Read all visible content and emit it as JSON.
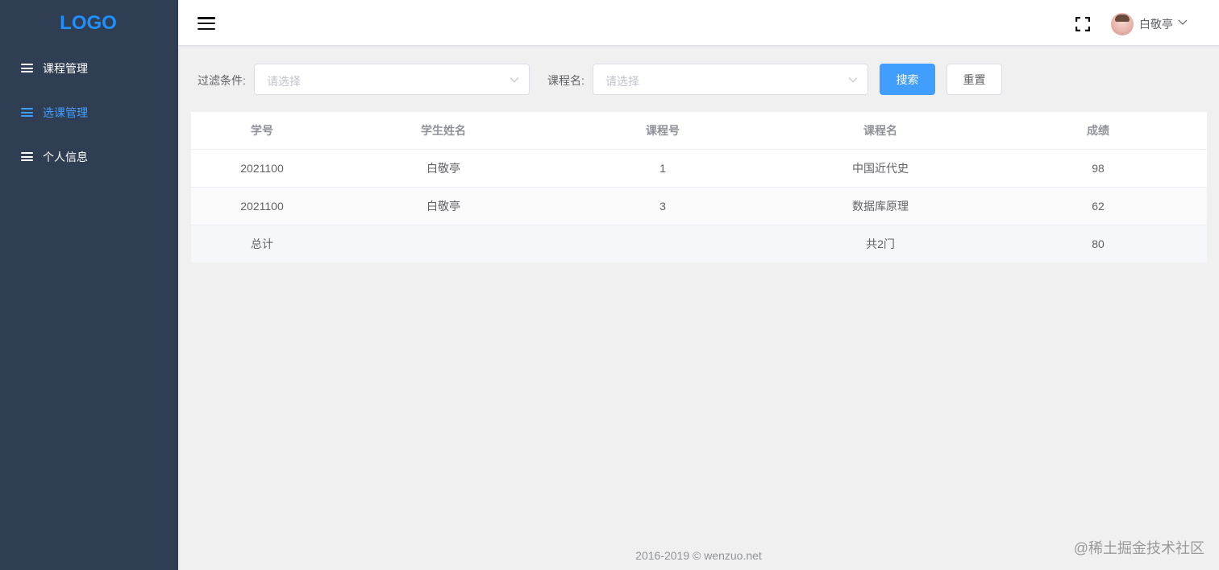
{
  "sidebar": {
    "logo": "LOGO",
    "items": [
      {
        "label": "课程管理",
        "active": false
      },
      {
        "label": "选课管理",
        "active": true
      },
      {
        "label": "个人信息",
        "active": false
      }
    ]
  },
  "header": {
    "username": "白敬亭",
    "icons": [
      "hamburger-icon",
      "fullscreen-icon",
      "chevron-down-icon"
    ]
  },
  "filters": {
    "filter_label": "过滤条件:",
    "filter_placeholder": "请选择",
    "course_label": "课程名:",
    "course_placeholder": "请选择",
    "search_button": "搜索",
    "reset_button": "重置"
  },
  "table": {
    "columns": [
      "学号",
      "学生姓名",
      "课程号",
      "课程名",
      "成绩"
    ],
    "rows": [
      [
        "2021100",
        "白敬亭",
        "1",
        "中国近代史",
        "98"
      ],
      [
        "2021100",
        "白敬亭",
        "3",
        "数据库原理",
        "62"
      ]
    ],
    "summary": [
      "总计",
      "",
      "",
      "共2门",
      "80"
    ]
  },
  "footer": {
    "copyright": "2016-2019 © wenzuo.net"
  },
  "watermark": "@稀土掘金技术社区",
  "colors": {
    "sidebar_bg": "#2f3e52",
    "accent": "#409eff",
    "logo": "#1e90ff",
    "page_bg": "#f0f0f0"
  }
}
